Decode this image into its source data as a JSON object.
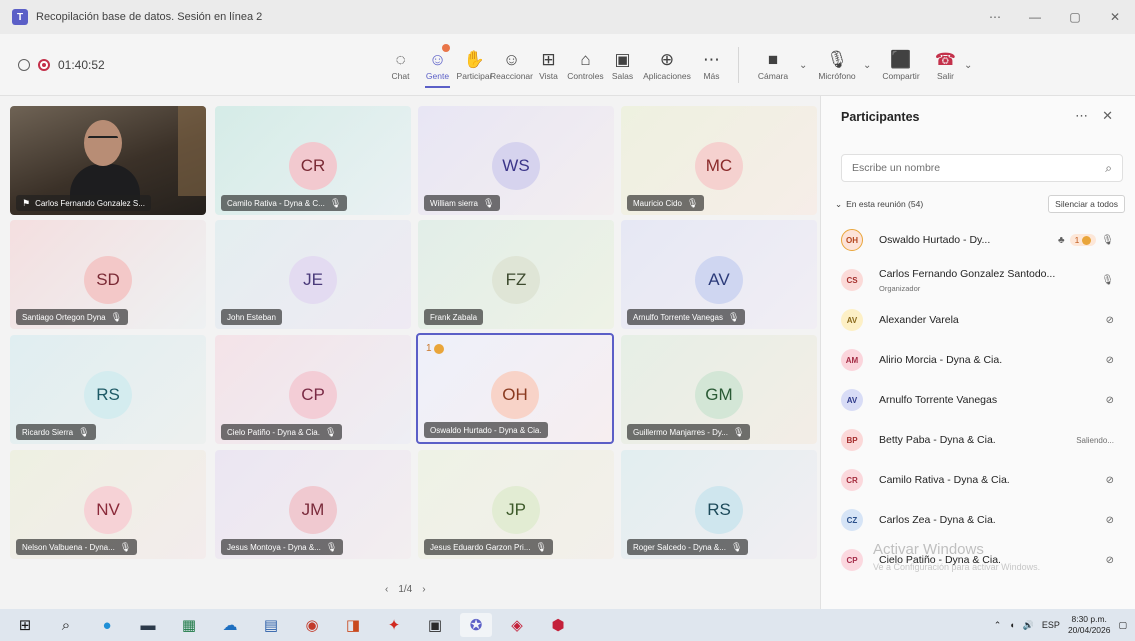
{
  "window": {
    "title": "Recopilación base de datos. Sesión en línea 2",
    "controls": [
      "⋯",
      "—",
      "▢",
      "✕"
    ]
  },
  "recording": {
    "time": "01:40:52"
  },
  "toolbar": {
    "chat": "Chat",
    "people": "Gente",
    "raise_hand": "Participar",
    "react": "Reaccionar",
    "view": "Vista",
    "controls": "Controles",
    "rooms": "Salas",
    "apps": "Aplicaciones",
    "more": "Más",
    "camera": "Cámara",
    "mic": "Micrófono",
    "share": "Compartir",
    "leave": "Salir"
  },
  "grid": {
    "video_tile_name": "Carlos Fernando Gonzalez S...",
    "tiles": [
      {
        "initials": "CR",
        "name": "Camilo Rativa - Dyna & C..."
      },
      {
        "initials": "WS",
        "name": "William sierra"
      },
      {
        "initials": "MC",
        "name": "Mauricio Cido"
      },
      {
        "initials": "SD",
        "name": "Santiago Ortegon Dyna"
      },
      {
        "initials": "JE",
        "name": "John Esteban"
      },
      {
        "initials": "FZ",
        "name": "Frank Zabala"
      },
      {
        "initials": "AV",
        "name": "Arnulfo Torrente Vanegas"
      },
      {
        "initials": "RS",
        "name": "Ricardo Sierra"
      },
      {
        "initials": "CP",
        "name": "Cielo Patiño - Dyna & Cia."
      },
      {
        "initials": "OH",
        "name": "Oswaldo Hurtado - Dyna & Cia.",
        "hand": "1"
      },
      {
        "initials": "GM",
        "name": "Guillermo Manjarres - Dy..."
      },
      {
        "initials": "NV",
        "name": "Nelson Valbuena - Dyna..."
      },
      {
        "initials": "JM",
        "name": "Jesus Montoya - Dyna &..."
      },
      {
        "initials": "JP",
        "name": "Jesus Eduardo Garzon Pri..."
      },
      {
        "initials": "RS",
        "name": "Roger Salcedo - Dyna &..."
      }
    ],
    "pager": "1/4"
  },
  "panel": {
    "title": "Participantes",
    "search_placeholder": "Escribe un nombre",
    "section": "En esta reunión (54)",
    "mute_all": "Silenciar a todos",
    "participants": [
      {
        "initials": "OH",
        "name": "Oswaldo Hurtado - Dy...",
        "hand": "1"
      },
      {
        "initials": "CS",
        "name": "Carlos Fernando Gonzalez Santodo...",
        "role": "Organizador"
      },
      {
        "initials": "AV",
        "name": "Alexander Varela"
      },
      {
        "initials": "AM",
        "name": "Alirio Morcia - Dyna & Cia."
      },
      {
        "initials": "AV",
        "name": "Arnulfo Torrente Vanegas"
      },
      {
        "initials": "BP",
        "name": "Betty Paba - Dyna & Cia.",
        "status": "Saliendo..."
      },
      {
        "initials": "CR",
        "name": "Camilo Rativa - Dyna & Cia."
      },
      {
        "initials": "CZ",
        "name": "Carlos Zea - Dyna & Cia."
      },
      {
        "initials": "CP",
        "name": "Cielo Patiño - Dyna & Cia."
      }
    ],
    "watermark": "Activar Windows",
    "watermark_sub": "Ve a Configuración para activar Windows."
  },
  "taskbar": {
    "lang": "ESP",
    "time": "8:30 p.m.",
    "date": "20/04/2026"
  }
}
